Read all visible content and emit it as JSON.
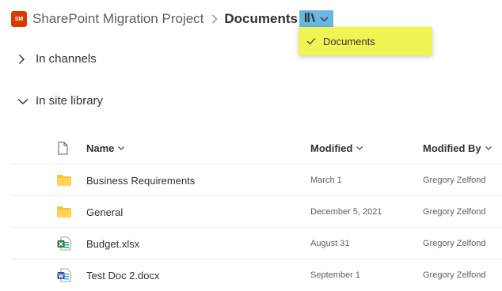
{
  "header": {
    "site_logo_text": "SM",
    "site_name": "SharePoint Migration Project",
    "current_library": "Documents"
  },
  "library_menu": {
    "icon": "library-icon",
    "items": [
      {
        "label": "Documents",
        "checked": true
      }
    ],
    "highlight_color": "#f1f553"
  },
  "groups": {
    "channels": {
      "label": "In channels",
      "expanded": false
    },
    "site_library": {
      "label": "In site library",
      "expanded": true
    }
  },
  "columns": {
    "file_type_icon": "document-icon",
    "name": "Name",
    "modified": "Modified",
    "modified_by": "Modified By"
  },
  "files": [
    {
      "icon": "folder-icon",
      "name": "Business Requirements",
      "modified": "March 1",
      "modified_by": "Gregory Zelfond"
    },
    {
      "icon": "folder-icon",
      "name": "General",
      "modified": "December 5, 2021",
      "modified_by": "Gregory Zelfond"
    },
    {
      "icon": "excel-icon",
      "name": "Budget.xlsx",
      "modified": "August 31",
      "modified_by": "Gregory Zelfond"
    },
    {
      "icon": "word-icon",
      "name": "Test Doc 2.docx",
      "modified": "September 1",
      "modified_by": "Gregory Zelfond"
    }
  ],
  "colors": {
    "site_logo": "#d83b01",
    "library_switch": "#6ab7e5",
    "folder": "#f8c23a",
    "excel": "#217346",
    "word": "#2b579a"
  }
}
